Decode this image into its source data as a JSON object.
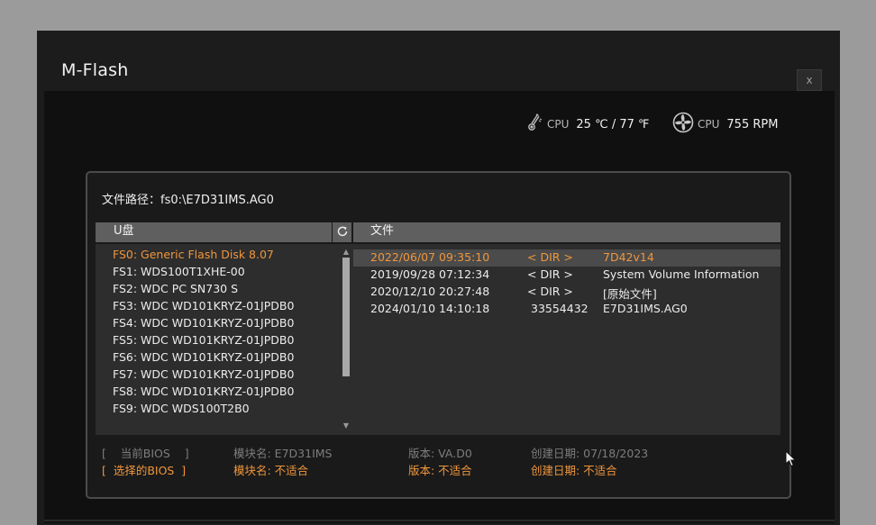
{
  "window": {
    "title": "M-Flash",
    "close_label": "x"
  },
  "hw_monitor": {
    "cpu_temp_label": "CPU",
    "cpu_temp_value": "25 ℃ / 77 ℉",
    "cpu_fan_label": "CPU",
    "cpu_fan_value": "755 RPM"
  },
  "path": {
    "text": "文件路径：fs0:\\E7D31IMS.AG0"
  },
  "usb_panel": {
    "header": "U盘",
    "items": [
      "FS0: Generic Flash Disk 8.07",
      "FS1: WDS100T1XHE-00",
      "FS2: WDC PC SN730 S",
      "FS3: WDC WD101KRYZ-01JPDB0",
      "FS4: WDC WD101KRYZ-01JPDB0",
      "FS5: WDC WD101KRYZ-01JPDB0",
      "FS6: WDC WD101KRYZ-01JPDB0",
      "FS7: WDC WD101KRYZ-01JPDB0",
      "FS8: WDC WD101KRYZ-01JPDB0",
      "FS9: WDC WDS100T2B0"
    ],
    "selected_index": 0
  },
  "file_panel": {
    "header": "文件",
    "rows": [
      {
        "date": "2022/06/07 09:35:10",
        "type": "< DIR >",
        "name": "7D42v14"
      },
      {
        "date": "2019/09/28 07:12:34",
        "type": "< DIR >",
        "name": "System Volume Information"
      },
      {
        "date": "2020/12/10 20:27:48",
        "type": "< DIR >",
        "name": "[原始文件]"
      },
      {
        "date": "2024/01/10 14:10:18",
        "type": "33554432",
        "name": "E7D31IMS.AG0"
      }
    ],
    "highlighted_index": 0
  },
  "bios_info": {
    "current": {
      "label": "[    当前BIOS    ]",
      "module": "模块名: E7D31IMS",
      "version": "版本: VA.D0",
      "date": "创建日期: 07/18/2023"
    },
    "selected": {
      "label": "[  选择的BIOS  ]",
      "module": "模块名: 不适合",
      "version": "版本: 不适合",
      "date": "创建日期: 不适合"
    }
  },
  "colors": {
    "accent": "#f0963c",
    "background": "#1a1a1a",
    "header_bar": "#5f5f5f",
    "list_bg": "#2d2d2d"
  },
  "icons": [
    "thermometer-icon",
    "fan-icon",
    "refresh-icon",
    "scroll-up-icon",
    "scroll-down-icon",
    "mouse-cursor-icon"
  ]
}
